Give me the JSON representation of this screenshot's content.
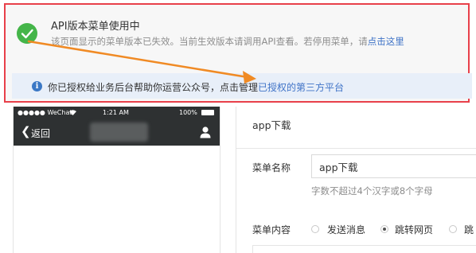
{
  "notice": {
    "title": "API版本菜单使用中",
    "description": "该页面显示的菜单版本已失效。当前生效版本请调用API查看。若停用菜单，请",
    "link": "点击这里"
  },
  "info_bar": {
    "text": "你已授权给业务后台帮助你运营公众号，点击管理",
    "link": "已授权的第三方平台"
  },
  "phone": {
    "carrier": "●●●●● WeChat",
    "time": "1:21 AM",
    "battery": "100%",
    "back_label": "返回"
  },
  "editor": {
    "menu_title": "app下载",
    "name_label": "菜单名称",
    "name_value": "app下载",
    "name_hint": "字数不超过4个汉字或8个字母",
    "content_label": "菜单内容",
    "options": [
      {
        "label": "发送消息",
        "checked": false
      },
      {
        "label": "跳转网页",
        "checked": true
      },
      {
        "label": "跳",
        "checked": false
      }
    ]
  },
  "colors": {
    "success": "#44b549",
    "alert_border": "#e8404a",
    "link": "#3f73c7",
    "arrow": "#f08a24",
    "phone_bar": "#2e3132"
  },
  "icons": [
    "check-icon",
    "info-icon",
    "back-chevron-icon",
    "user-icon",
    "wifi-icon",
    "battery-icon"
  ]
}
